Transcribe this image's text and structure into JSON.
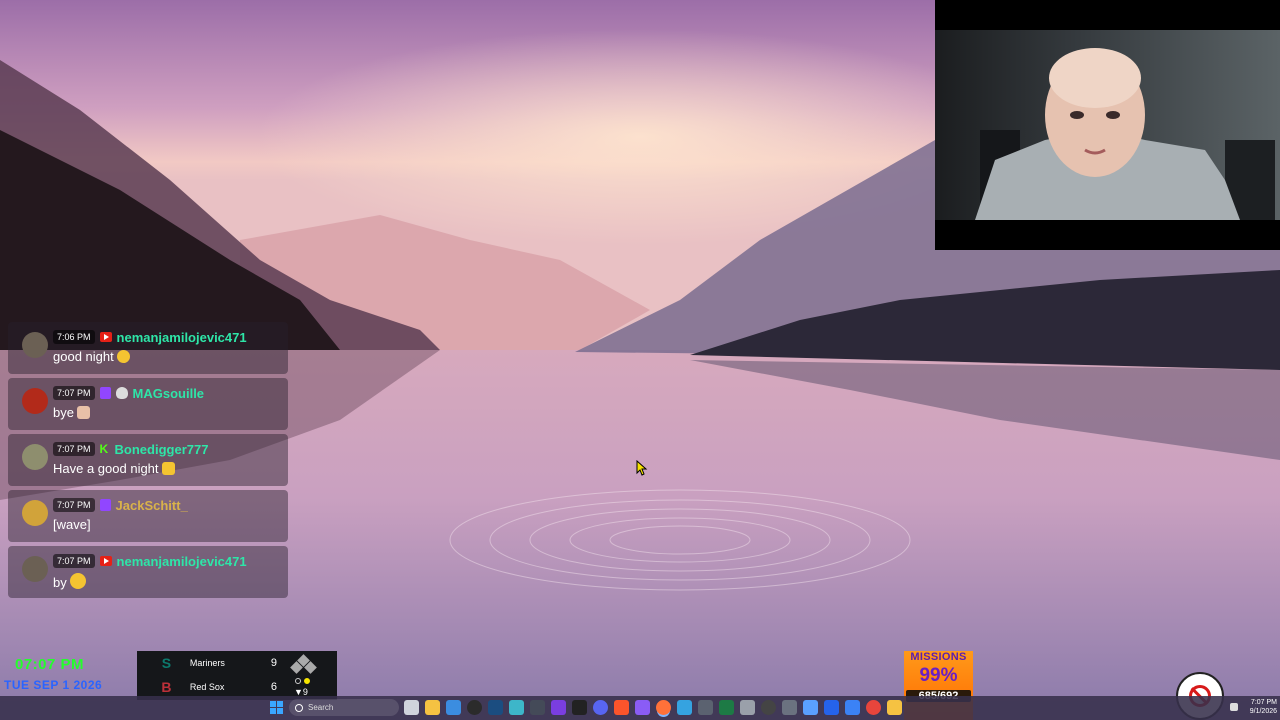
{
  "webcam": {
    "icon": "webcam-feed"
  },
  "chat": {
    "messages": [
      {
        "time": "7:06 PM",
        "platform": "youtube",
        "user": "nemanjamilojevic471",
        "text": "good night",
        "emoji": true,
        "badge": ""
      },
      {
        "time": "7:07 PM",
        "platform": "twitch",
        "user": "MAGsouille",
        "text": "bye",
        "emoji": true,
        "badge": "skull"
      },
      {
        "time": "7:07 PM",
        "platform": "kick",
        "user": "Bonedigger777",
        "text": "Have a good night",
        "emoji": true,
        "badge": ""
      },
      {
        "time": "7:07 PM",
        "platform": "twitch",
        "user": "JackSchitt_",
        "text": "[wave]",
        "emoji": false,
        "badge": ""
      },
      {
        "time": "7:07 PM",
        "platform": "youtube",
        "user": "nemanjamilojevic471",
        "text": "by",
        "emoji": true,
        "badge": ""
      }
    ]
  },
  "clock": {
    "time": "07:07 PM",
    "date": "TUE SEP 1 2026"
  },
  "scoreboard": {
    "teams": [
      {
        "name": "Mariners",
        "score": "9",
        "color": "#0c7a6d",
        "logo": "S"
      },
      {
        "name": "Red Sox",
        "score": "6",
        "color": "#bd3039",
        "logo": "B"
      }
    ],
    "inning": "▼9",
    "outs": 1
  },
  "missions": {
    "title": "MISSIONS",
    "percent": "99%",
    "count": "685/692"
  },
  "taskbar": {
    "search_placeholder": "Search",
    "tray_time": "7:07 PM",
    "tray_date": "9/1/2026",
    "icons": [
      "task-view-icon",
      "file-explorer-icon",
      "store-icon",
      "obs-icon",
      "steam-icon",
      "capture-icon",
      "media-icon",
      "terminal-icon",
      "paint-icon",
      "discord-icon",
      "brave-icon",
      "app-icon",
      "firefox-icon",
      "notepad-icon",
      "calculator-icon",
      "excel-icon",
      "usb-icon",
      "settings-icon",
      "app-icon-2",
      "app-icon-3",
      "photos-icon",
      "grid-icon",
      "chrome-icon",
      "folder-icon"
    ]
  }
}
